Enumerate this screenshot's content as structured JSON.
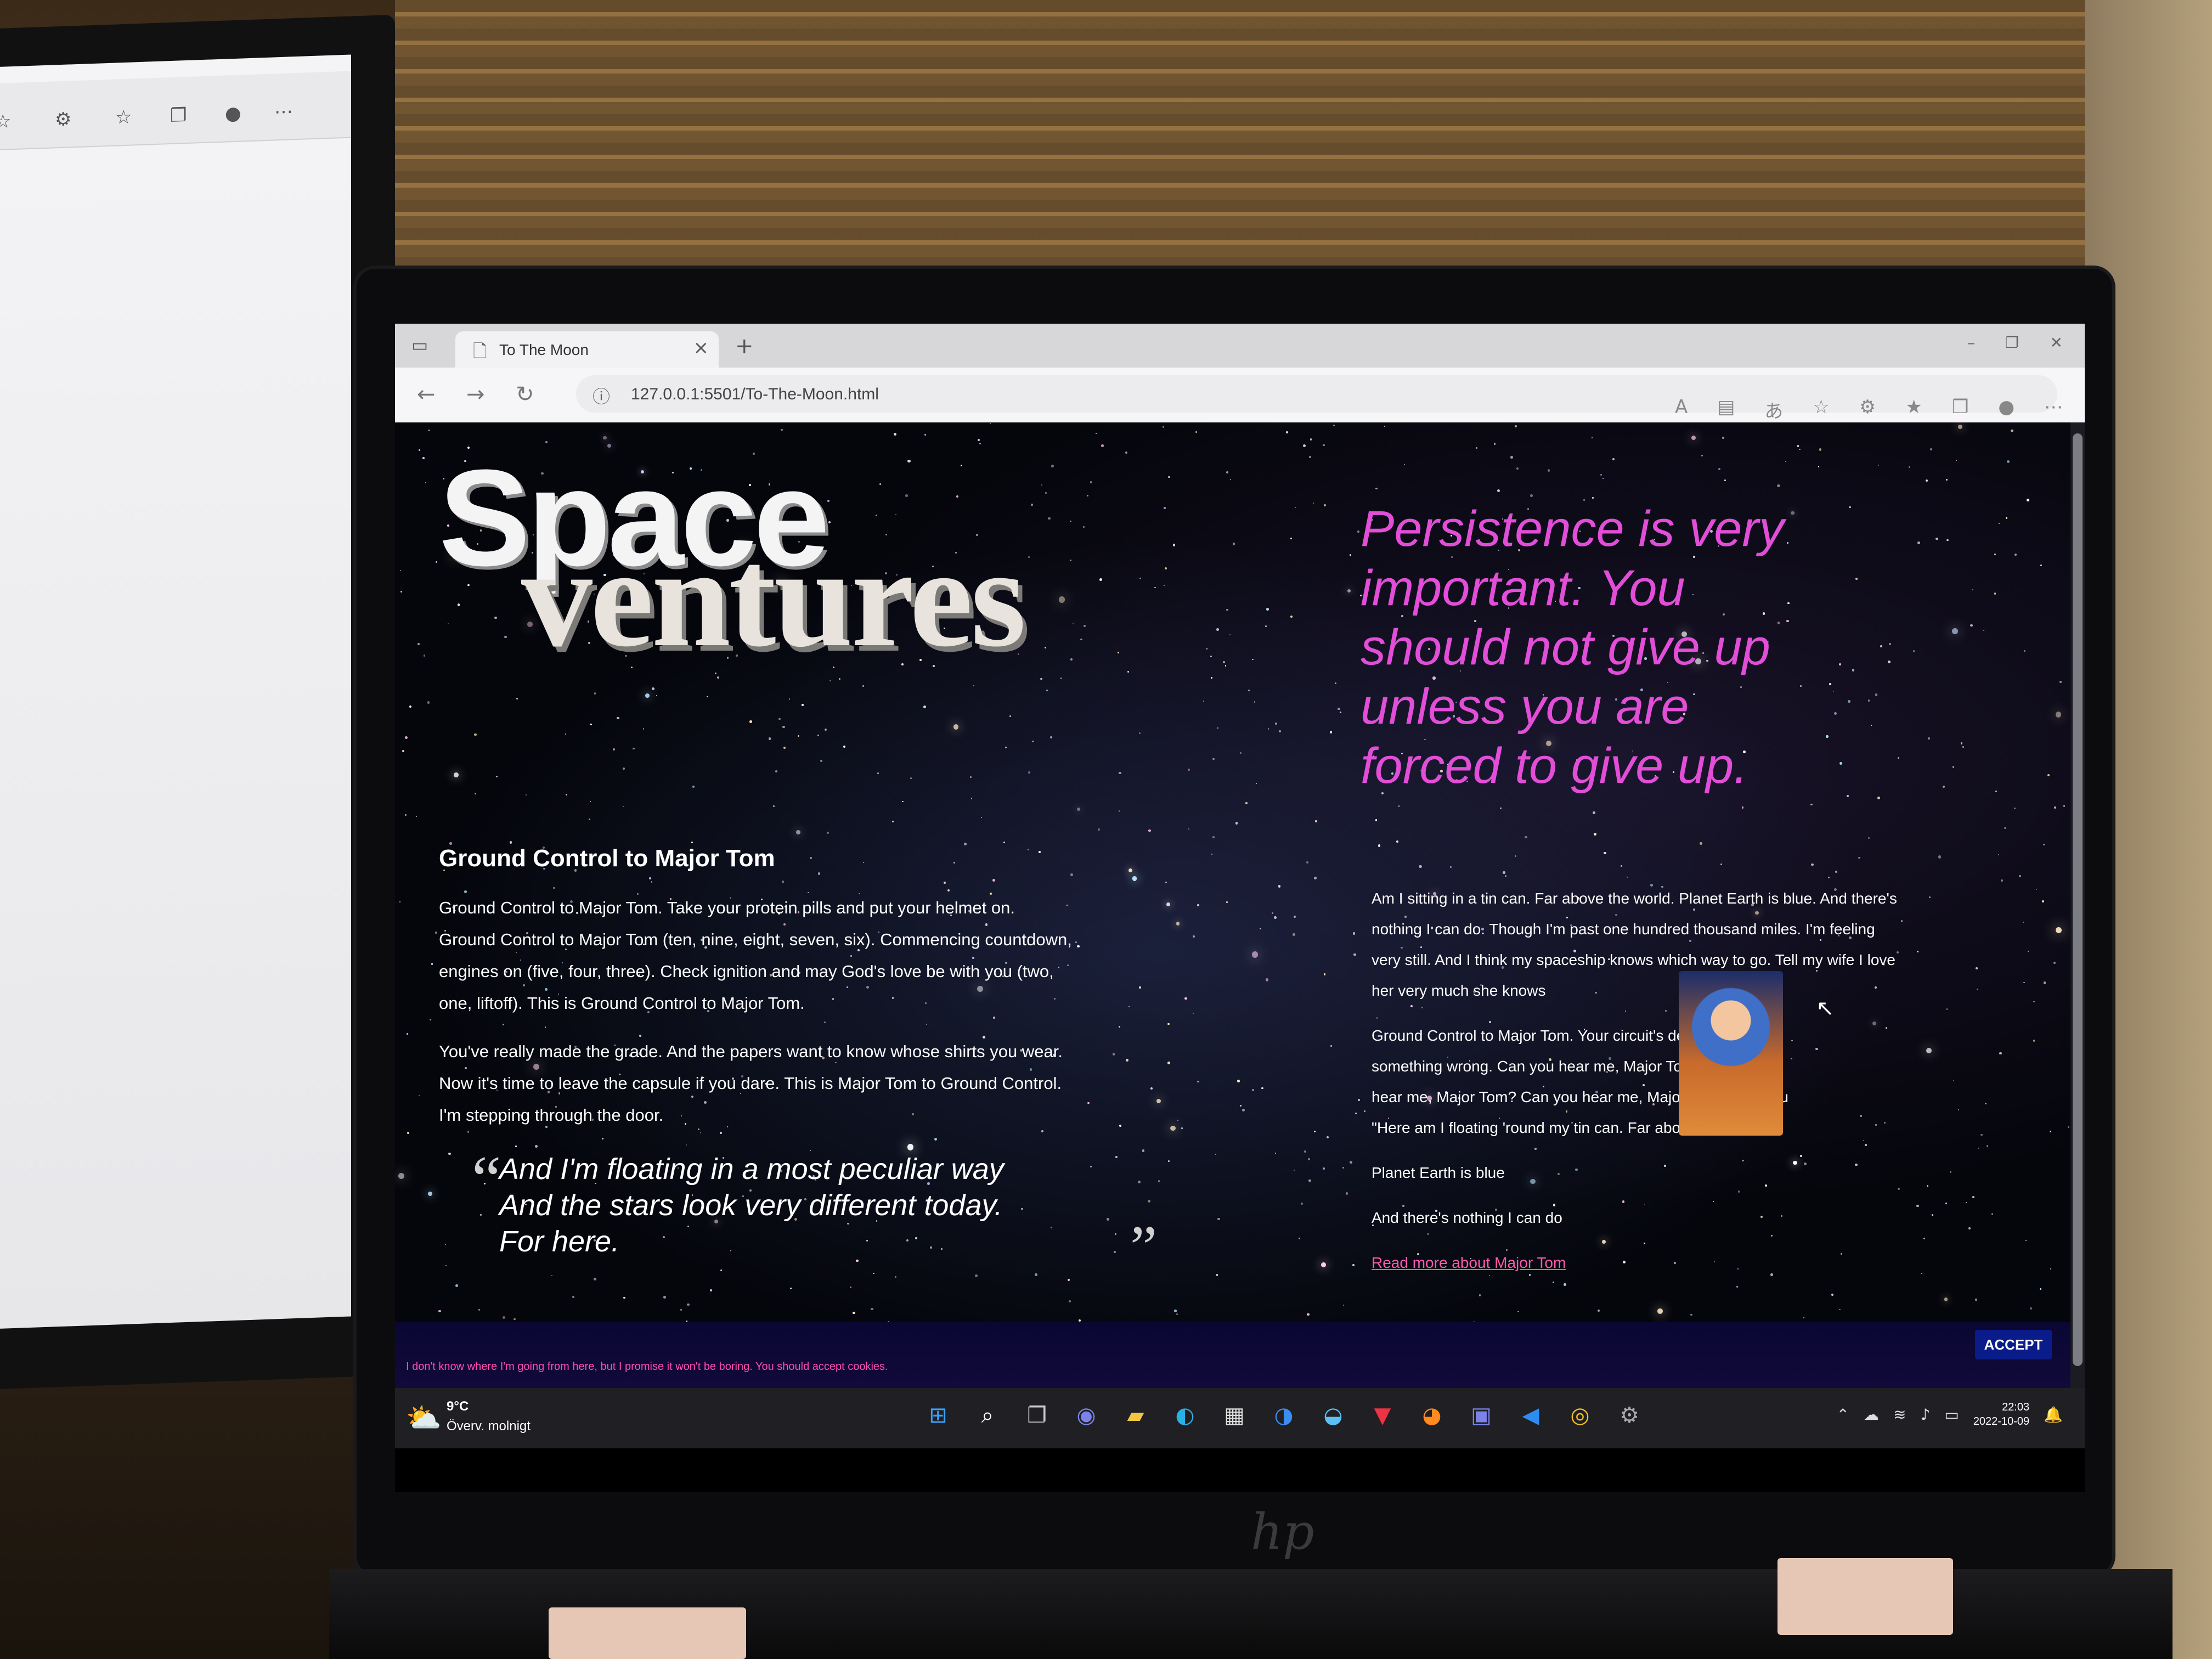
{
  "browser": {
    "tab_title": "To The Moon",
    "url": "127.0.0.1:5501/To-The-Moon.html"
  },
  "logo": {
    "line1": "Space",
    "line2": "ventures"
  },
  "quote_pink": "Persistence is very important. You should not give up unless you are forced to give up.",
  "left": {
    "heading": "Ground Control to Major Tom",
    "p1": "Ground Control to Major Tom. Take your protein pills and put your helmet on. Ground Control to Major Tom (ten, nine, eight, seven, six). Commencing countdown, engines on (five, four, three). Check ignition and may God's love be with you (two, one, liftoff). This is Ground Control to Major Tom.",
    "p2": "You've really made the grade. And the papers want to know whose shirts you wear. Now it's time to leave the capsule if you dare. This is Major Tom to Ground Control. I'm stepping through the door.",
    "quote_lines": [
      "And I'm floating in a most peculiar way",
      "And the stars look very different today.",
      "For here."
    ]
  },
  "right": {
    "p1": "Am I sitting in a tin can. Far above the world. Planet Earth is blue. And there's nothing I can do. Though I'm past one hundred thousand miles. I'm feeling very still. And I think my spaceship knows which way to go. Tell my wife I love her very much she knows",
    "p2": "Ground Control to Major Tom. Your circuit's dead, there's something wrong. Can you hear me, Major Tom? Can you hear me, Major Tom? Can you hear me, Major Tom? Can you \"Here am I floating 'round my tin can. Far above the moon",
    "p3": "Planet Earth is blue",
    "p4": "And there's nothing I can do",
    "link": "Read more about Major Tom"
  },
  "cookie": {
    "text": "I don't know where I'm going from here, but I promise it won't be boring. You should accept cookies.",
    "button": "ACCEPT"
  },
  "taskbar": {
    "temp": "9°C",
    "weather": "Överv. molnigt",
    "time": "22:03",
    "date": "2022-10-09"
  }
}
